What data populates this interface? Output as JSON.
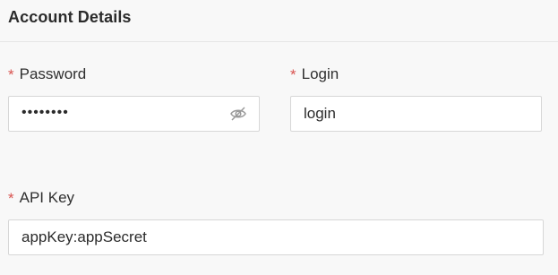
{
  "section": {
    "title": "Account Details"
  },
  "fields": {
    "password": {
      "required_mark": "*",
      "label": "Password",
      "masked_value": "••••••••"
    },
    "login": {
      "required_mark": "*",
      "label": "Login",
      "value": "login"
    },
    "api_key": {
      "required_mark": "*",
      "label": "API Key",
      "value": "appKey:appSecret"
    }
  },
  "icons": {
    "password_toggle": "eye-slash-icon"
  },
  "colors": {
    "required": "#d9534f",
    "background": "#f8f8f8",
    "input_border": "#d7d7d7"
  }
}
